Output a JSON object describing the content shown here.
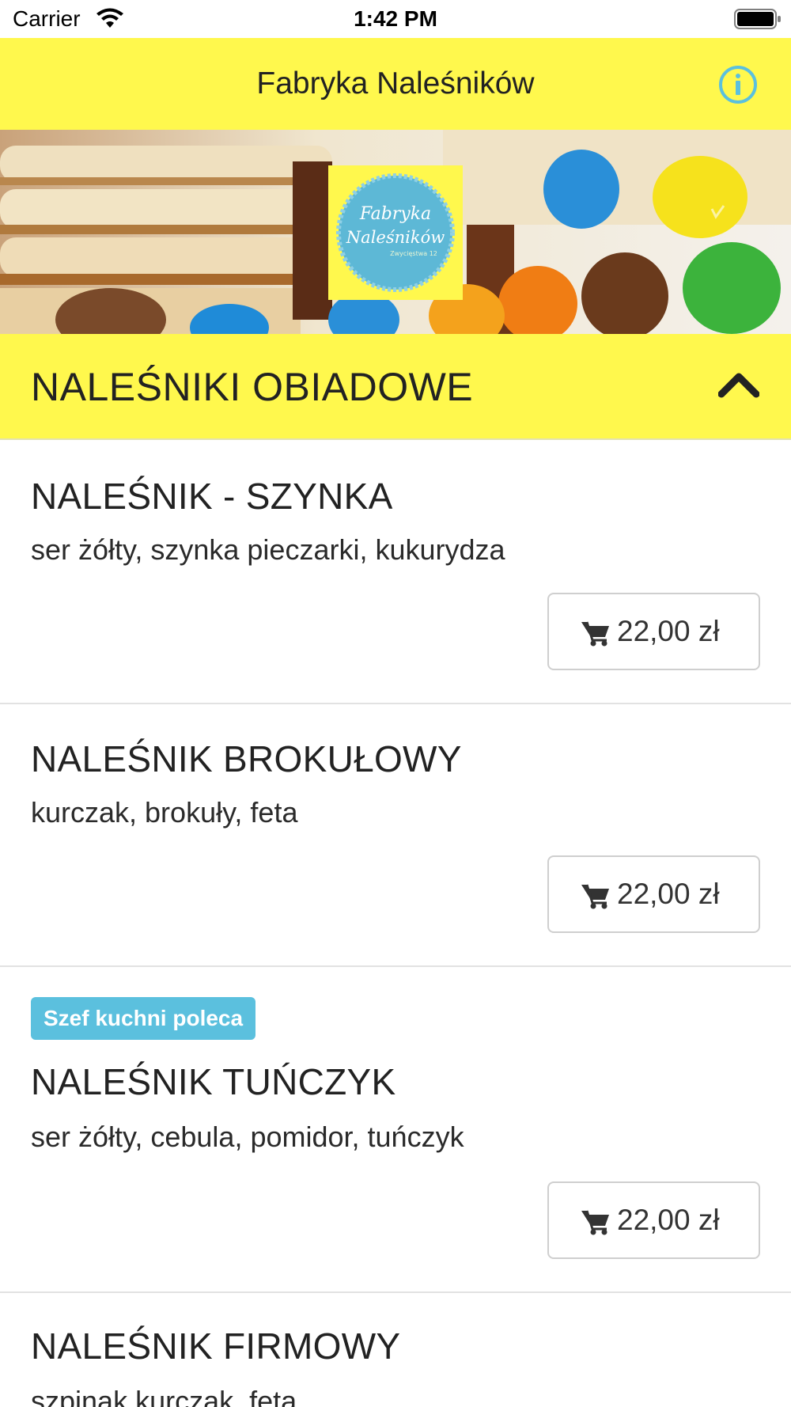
{
  "status_bar": {
    "carrier": "Carrier",
    "time": "1:42 PM",
    "wifi_icon": "wifi-icon",
    "battery_icon": "battery-icon"
  },
  "nav": {
    "title": "Fabryka Naleśników",
    "info_icon": "info-icon"
  },
  "hero": {
    "logo_text_line1": "Fabryka",
    "logo_text_line2": "Naleśników",
    "logo_text_line3": "Zwycięstwa 12"
  },
  "section": {
    "title": "NALEŚNIKI OBIADOWE",
    "toggle_icon": "chevron-up-icon",
    "expanded": true
  },
  "items": [
    {
      "name": "NALEŚNIK - SZYNKA",
      "description": "ser żółty, szynka pieczarki, kukurydza",
      "price": "22,00 zł",
      "badge": ""
    },
    {
      "name": "NALEŚNIK BROKUŁOWY",
      "description": "kurczak, brokuły, feta",
      "price": "22,00 zł",
      "badge": ""
    },
    {
      "name": "NALEŚNIK TUŃCZYK",
      "description": "ser żółty, cebula, pomidor, tuńczyk",
      "price": "22,00 zł",
      "badge": "Szef kuchni poleca"
    },
    {
      "name": "NALEŚNIK FIRMOWY",
      "description": "szpinak kurczak, feta",
      "price": "",
      "badge": ""
    }
  ],
  "colors": {
    "header_yellow": "#fff84d",
    "info_blue": "#5bc0de",
    "badge_blue": "#5bc0de",
    "text_dark": "#222222",
    "divider": "#e2e2e2"
  }
}
